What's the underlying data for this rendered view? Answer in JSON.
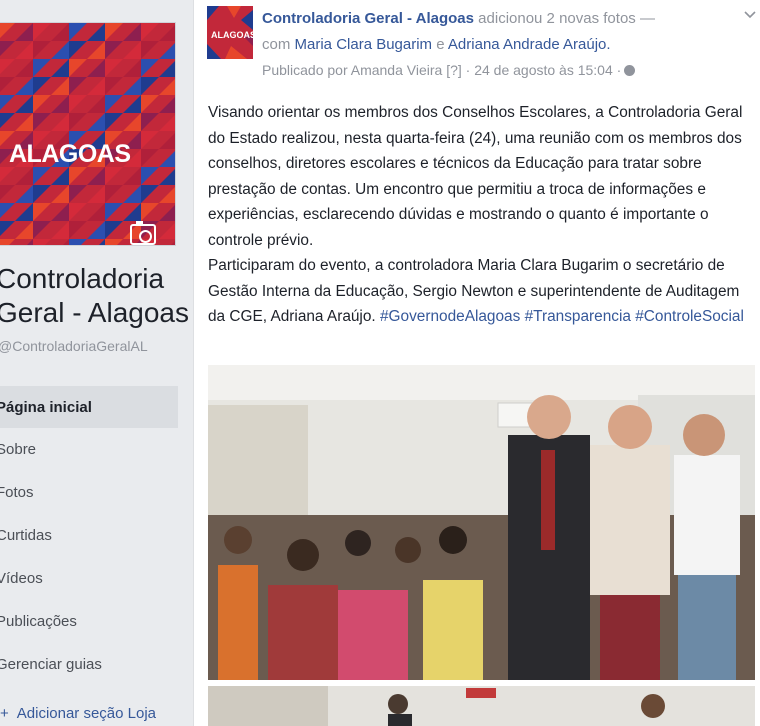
{
  "page": {
    "cover_text": "ALAGOAS",
    "name_line1": "Controladoria",
    "name_line2": "Geral - Alagoas",
    "handle": "@ControladoriaGeralAL",
    "nav": [
      {
        "label": "Página inicial",
        "active": true
      },
      {
        "label": "Sobre"
      },
      {
        "label": "Fotos"
      },
      {
        "label": "Curtidas"
      },
      {
        "label": "Vídeos"
      },
      {
        "label": "Publicações"
      },
      {
        "label": "Gerenciar guias"
      }
    ],
    "add_shop": "Adicionar seção Loja"
  },
  "post": {
    "avatar_text": "ALAGOAS",
    "author": "Controladoria Geral - Alagoas",
    "action": "adicionou 2 novas fotos —",
    "with_prefix": "com",
    "tag1": "Maria Clara Bugarim",
    "and": "e",
    "tag2": "Adriana Andrade Araújo.",
    "published_by": "Publicado por Amanda Vieira [?] · 24 de agosto às 15:04 ·",
    "paragraph1": "Visando orientar os membros dos Conselhos Escolares, a Controladoria Geral do Estado realizou, nesta quarta-feira (24), uma reunião com os membros dos conselhos, diretores escolares e técnicos da Educação para tratar sobre prestação de contas. Um encontro que permitiu a troca de informações e experiências, esclarecendo dúvidas e mostrando o quanto é importante o controle prévio.",
    "paragraph2": "Participaram do evento, a controladora Maria Clara Bugarim o secretário de Gestão Interna da Educação, Sergio Newton e superintendente de Auditagem da CGE, Adriana Araújo.",
    "hashtags": [
      "#GovernodeAlagoas",
      "#Transparencia",
      "#ControleSocial"
    ]
  },
  "colors": {
    "link": "#365899",
    "brand_red": "#d42a3a",
    "brand_blue": "#1f3c8f"
  }
}
